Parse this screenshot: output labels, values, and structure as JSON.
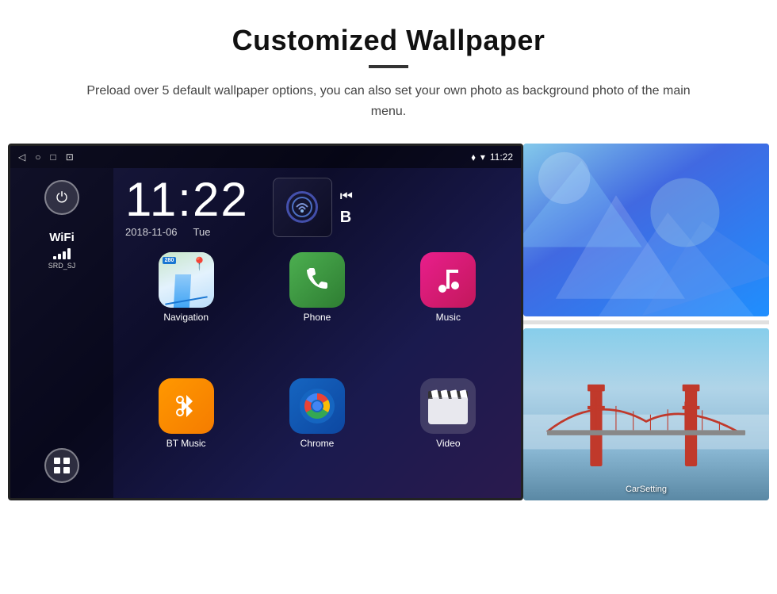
{
  "header": {
    "title": "Customized Wallpaper",
    "description": "Preload over 5 default wallpaper options, you can also set your own photo as background photo of the main menu."
  },
  "device": {
    "statusBar": {
      "navIcons": [
        "◁",
        "○",
        "□",
        "⊡"
      ],
      "rightIcons": [
        "location",
        "wifi",
        "time"
      ],
      "time": "11:22"
    },
    "clock": {
      "time": "11:22",
      "date": "2018-11-06",
      "day": "Tue"
    },
    "wifi": {
      "label": "WiFi",
      "ssid": "SRD_SJ"
    },
    "apps": [
      {
        "name": "Navigation",
        "icon": "navigation"
      },
      {
        "name": "Phone",
        "icon": "phone"
      },
      {
        "name": "Music",
        "icon": "music"
      },
      {
        "name": "BT Music",
        "icon": "btmusic"
      },
      {
        "name": "Chrome",
        "icon": "chrome"
      },
      {
        "name": "Video",
        "icon": "video"
      }
    ],
    "wallpapers": [
      {
        "name": "Ice Blue",
        "type": "ice"
      },
      {
        "name": "Golden Gate Bridge",
        "type": "bridge"
      }
    ],
    "carsetting": "CarSetting"
  }
}
